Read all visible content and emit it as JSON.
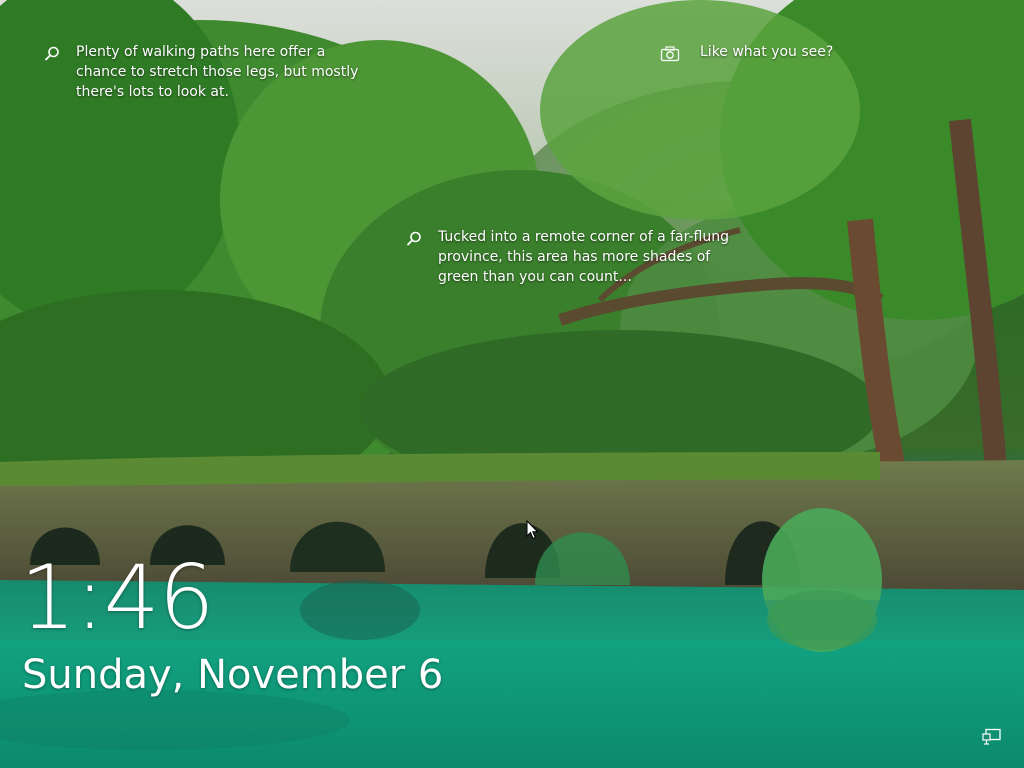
{
  "spotlight": {
    "hotspot_1": "Plenty of walking paths here offer a chance to stretch those legs, but mostly there's lots to look at.",
    "hotspot_2": "Tucked into a remote corner of a far-flung province, this area has more shades of green than you can count...",
    "like_label": "Like what you see?"
  },
  "clock": {
    "time": "1:46",
    "date": "Sunday, November 6"
  },
  "icons": {
    "hotspot": "search-icon",
    "like": "camera-icon",
    "network": "network-icon"
  },
  "colors": {
    "text": "#ffffff",
    "water": "#129c7c",
    "foliage": "#3a7a2e"
  }
}
